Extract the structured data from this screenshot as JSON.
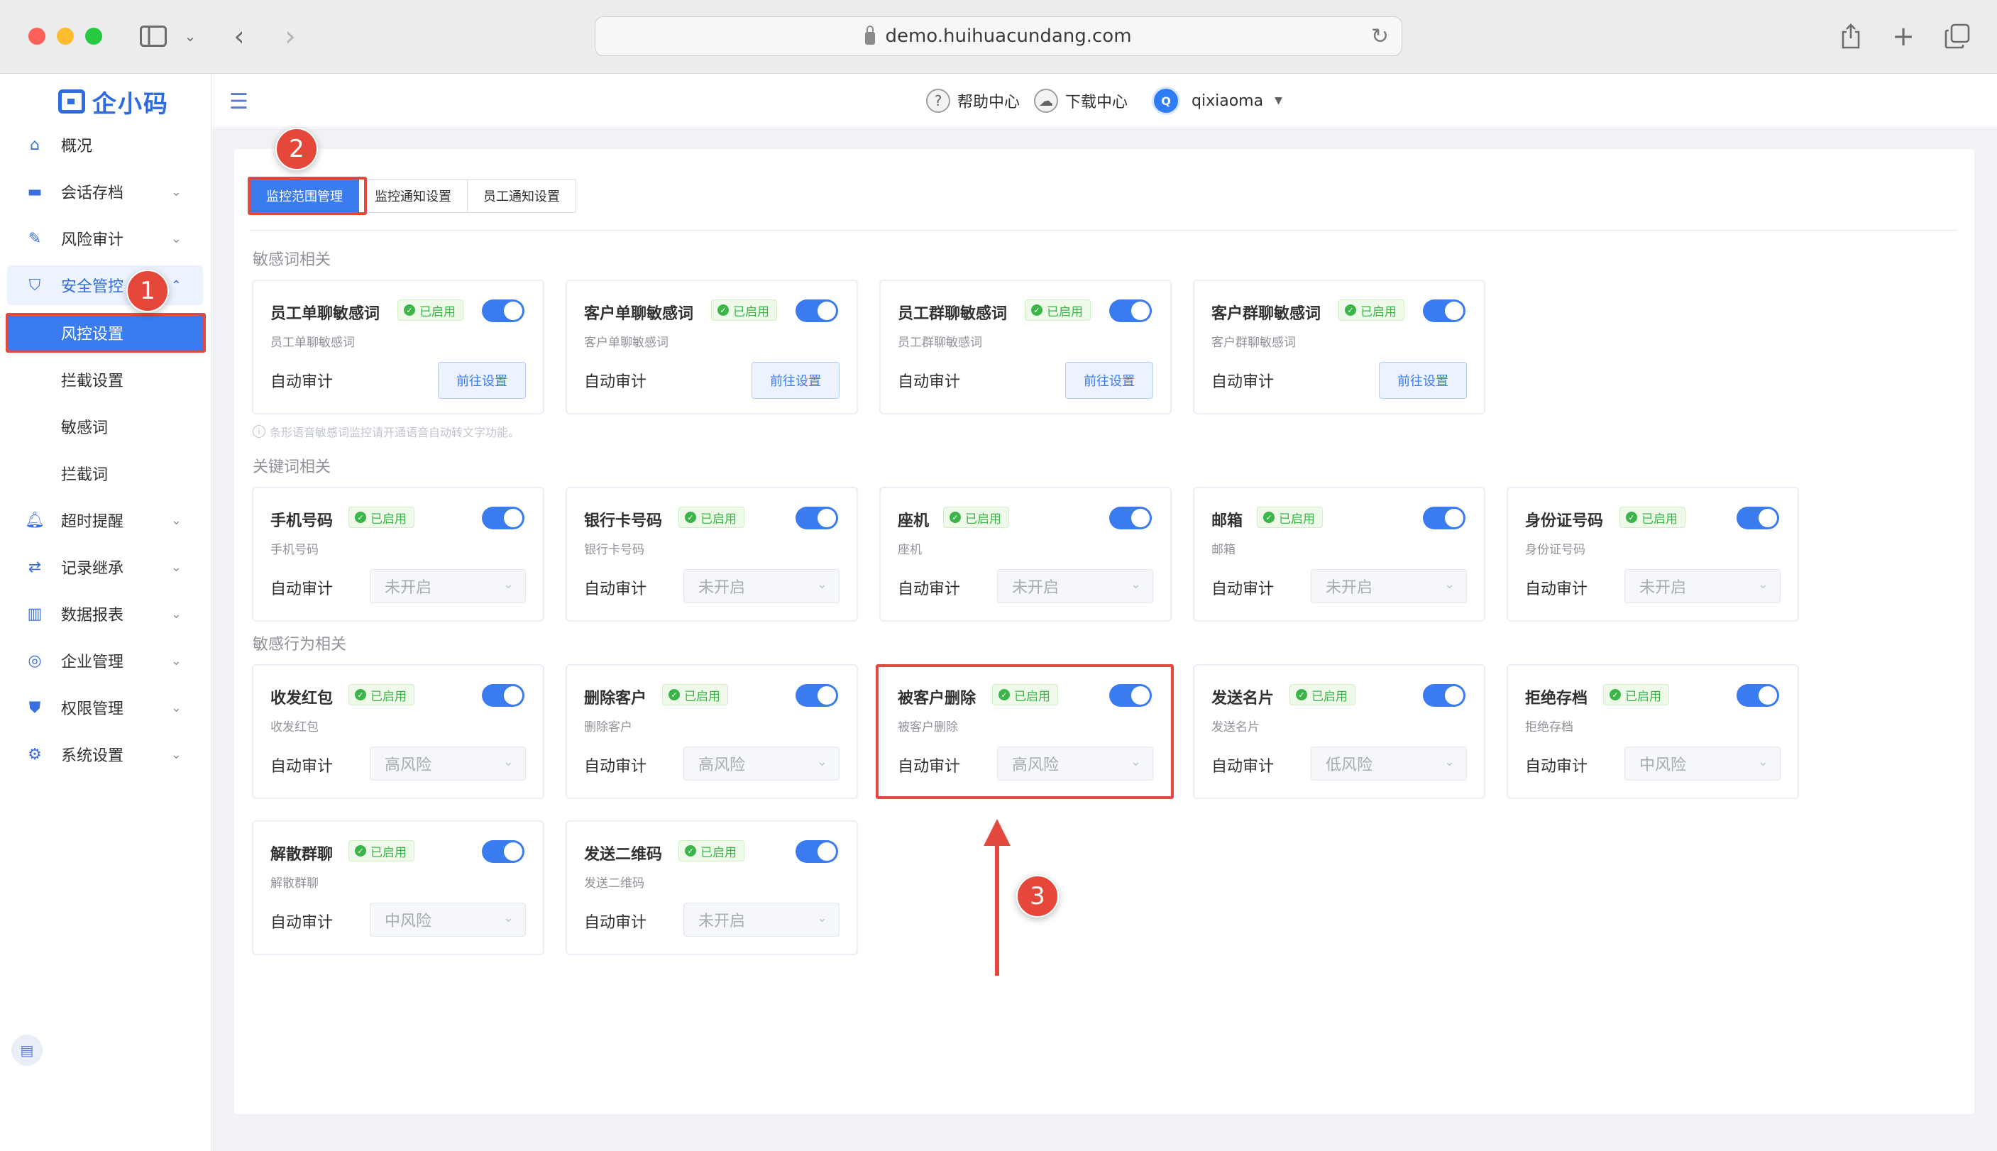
{
  "browser": {
    "url": "demo.huihuacundang.com"
  },
  "logo": {
    "text": "企小码"
  },
  "header": {
    "help": "帮助中心",
    "download": "下载中心",
    "avatar_letter": "Q",
    "user": "qixiaoma"
  },
  "sidebar": {
    "items": [
      {
        "label": "概况",
        "icon": "home-icon"
      },
      {
        "label": "会话存档",
        "icon": "folder-icon"
      },
      {
        "label": "风险审计",
        "icon": "audit-icon"
      },
      {
        "label": "安全管控",
        "icon": "shield-icon"
      },
      {
        "label": "超时提醒",
        "icon": "bell-icon"
      },
      {
        "label": "记录继承",
        "icon": "inherit-icon"
      },
      {
        "label": "数据报表",
        "icon": "chart-icon"
      },
      {
        "label": "企业管理",
        "icon": "company-icon"
      },
      {
        "label": "权限管理",
        "icon": "permission-icon"
      },
      {
        "label": "系统设置",
        "icon": "gear-icon"
      }
    ],
    "subitems": [
      "风控设置",
      "拦截设置",
      "敏感词",
      "拦截词"
    ]
  },
  "tabs": [
    "监控范围管理",
    "监控通知设置",
    "员工通知设置"
  ],
  "sections": {
    "sensitive_words": "敏感词相关",
    "keywords": "关键词相关",
    "behaviors": "敏感行为相关"
  },
  "note": "条形语音敏感词监控请开通语音自动转文字功能。",
  "status_label": "已启用",
  "audit_label": "自动审计",
  "cards": {
    "words": [
      {
        "title": "员工单聊敏感词",
        "sub": "员工单聊敏感词",
        "button": "前往设置"
      },
      {
        "title": "客户单聊敏感词",
        "sub": "客户单聊敏感词",
        "button": "前往设置"
      },
      {
        "title": "员工群聊敏感词",
        "sub": "员工群聊敏感词",
        "button": "前往设置"
      },
      {
        "title": "客户群聊敏感词",
        "sub": "客户群聊敏感词",
        "button": "前往设置"
      }
    ],
    "keywords": [
      {
        "title": "手机号码",
        "sub": "手机号码",
        "select": "未开启"
      },
      {
        "title": "银行卡号码",
        "sub": "银行卡号码",
        "select": "未开启"
      },
      {
        "title": "座机",
        "sub": "座机",
        "select": "未开启"
      },
      {
        "title": "邮箱",
        "sub": "邮箱",
        "select": "未开启"
      },
      {
        "title": "身份证号码",
        "sub": "身份证号码",
        "select": "未开启"
      }
    ],
    "behaviors": [
      {
        "title": "收发红包",
        "sub": "收发红包",
        "select": "高风险"
      },
      {
        "title": "删除客户",
        "sub": "删除客户",
        "select": "高风险"
      },
      {
        "title": "被客户删除",
        "sub": "被客户删除",
        "select": "高风险"
      },
      {
        "title": "发送名片",
        "sub": "发送名片",
        "select": "低风险"
      },
      {
        "title": "拒绝存档",
        "sub": "拒绝存档",
        "select": "中风险"
      },
      {
        "title": "解散群聊",
        "sub": "解散群聊",
        "select": "中风险"
      },
      {
        "title": "发送二维码",
        "sub": "发送二维码",
        "select": "未开启"
      }
    ]
  },
  "markers": [
    "1",
    "2",
    "3"
  ],
  "colors": {
    "primary": "#3b7bf0",
    "success": "#3bb54a",
    "annotation": "#e24a3f"
  }
}
